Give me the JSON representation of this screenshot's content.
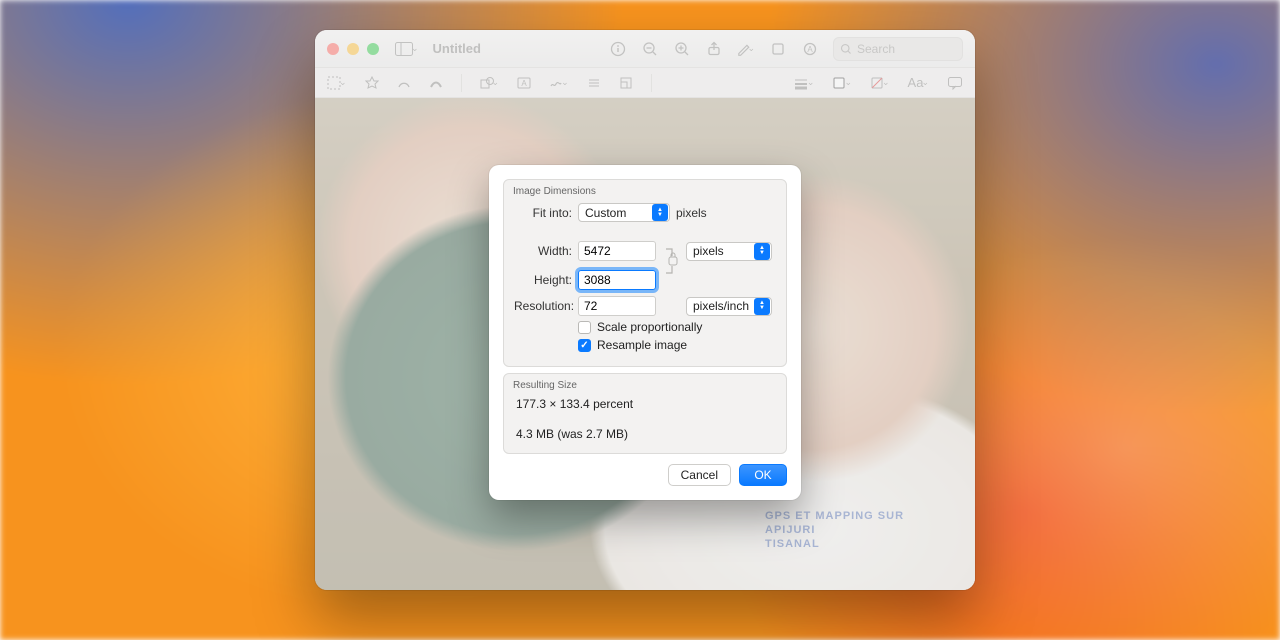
{
  "window": {
    "title": "Untitled",
    "search_placeholder": "Search"
  },
  "dialog": {
    "section1_title": "Image Dimensions",
    "fit_into_label": "Fit into:",
    "fit_into_value": "Custom",
    "fit_into_unit": "pixels",
    "width_label": "Width:",
    "width_value": "5472",
    "height_label": "Height:",
    "height_value": "3088",
    "size_unit_value": "pixels",
    "resolution_label": "Resolution:",
    "resolution_value": "72",
    "resolution_unit_value": "pixels/inch",
    "scale_label": "Scale proportionally",
    "resample_label": "Resample image",
    "section2_title": "Resulting Size",
    "result_percent": "177.3 × 133.4 percent",
    "result_size": "4.3 MB (was 2.7 MB)",
    "cancel": "Cancel",
    "ok": "OK"
  },
  "photo_text": {
    "l1": "GPS ET MAPPING SUR",
    "l2": "APIJURI",
    "l3": "TISANAL"
  }
}
